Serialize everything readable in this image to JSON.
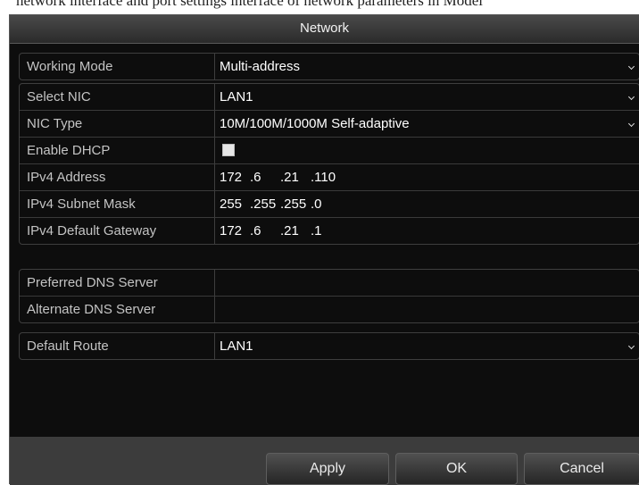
{
  "caption": "network interface and port settings interface of network parameters in Model",
  "dialog": {
    "title": "Network",
    "working_mode": {
      "label": "Working Mode",
      "value": "Multi-address"
    },
    "nic": {
      "select_nic": {
        "label": "Select NIC",
        "value": "LAN1"
      },
      "nic_type": {
        "label": "NIC Type",
        "value": "10M/100M/1000M Self-adaptive"
      },
      "enable_dhcp": {
        "label": "Enable DHCP",
        "checked": false
      },
      "ipv4_address": {
        "label": "IPv4 Address",
        "octets": [
          "172",
          ".6",
          ".21",
          ".110"
        ]
      },
      "ipv4_subnet_mask": {
        "label": "IPv4 Subnet Mask",
        "octets": [
          "255",
          ".255",
          ".255",
          ".0"
        ]
      },
      "ipv4_default_gateway": {
        "label": "IPv4 Default Gateway",
        "octets": [
          "172",
          ".6",
          ".21",
          ".1"
        ]
      }
    },
    "dns": {
      "preferred": {
        "label": "Preferred DNS Server",
        "value": ""
      },
      "alternate": {
        "label": "Alternate DNS Server",
        "value": ""
      }
    },
    "default_route": {
      "label": "Default Route",
      "value": "LAN1"
    },
    "buttons": {
      "apply": "Apply",
      "ok": "OK",
      "cancel": "Cancel"
    },
    "colors": {
      "background": "#0d0d0d",
      "title_bar": "#3a3a3a",
      "text": "#ffffff",
      "label_text": "#c4c4c4"
    },
    "icons": {
      "dropdown": "chevron-down-icon",
      "checkbox": "checkbox-unchecked"
    }
  }
}
